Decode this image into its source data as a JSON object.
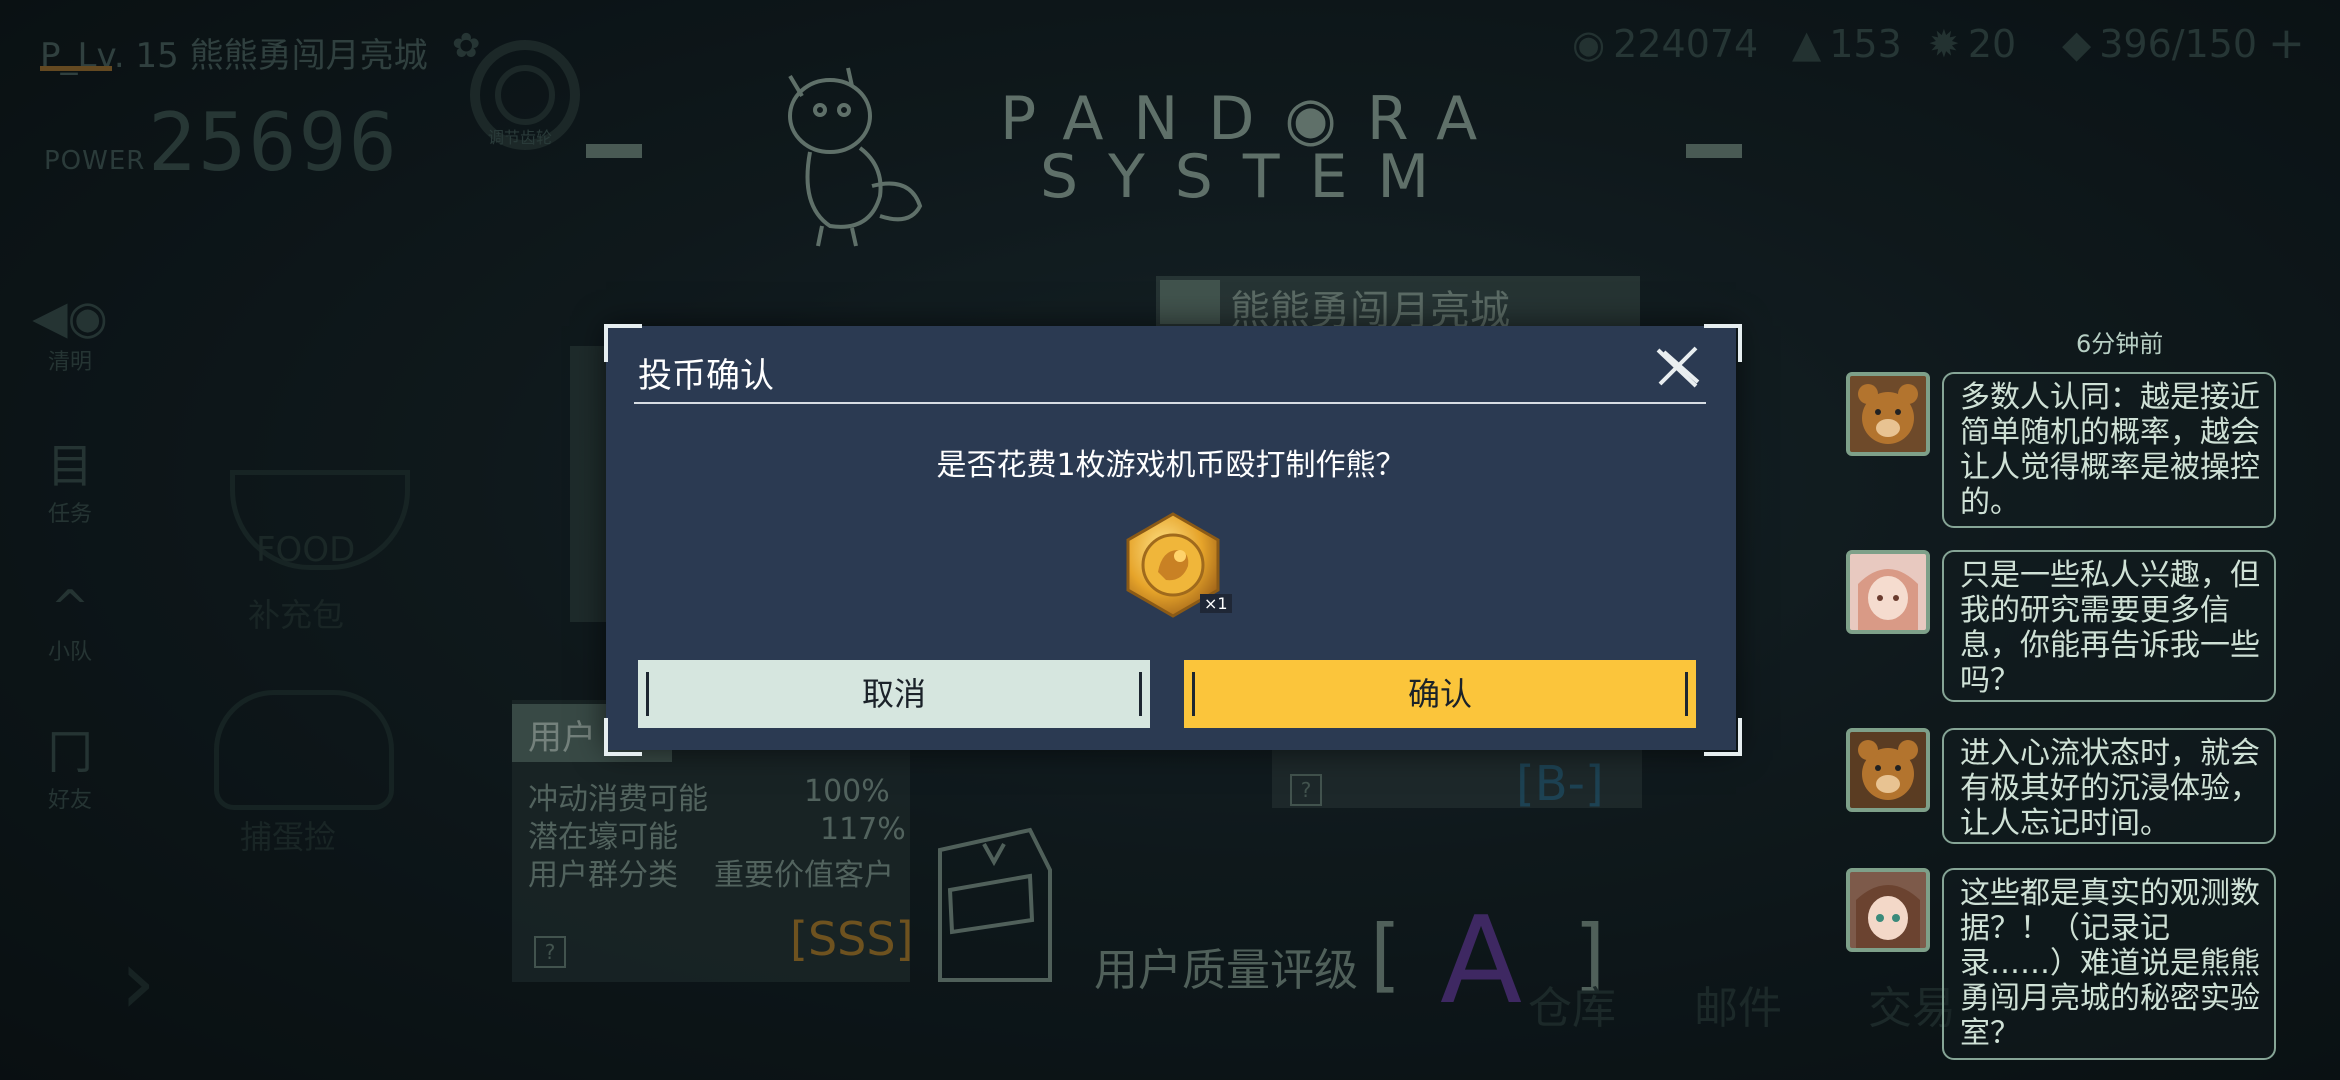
{
  "hud": {
    "player": "P_Lv. 15 熊熊勇闯月亮城",
    "power_label": "POWER",
    "power_value": "25696",
    "gear_label": "调节齿轮",
    "resources": [
      {
        "icon": "coin-stack-icon",
        "value": "224074"
      },
      {
        "icon": "warning-triangle-icon",
        "value": "153"
      },
      {
        "icon": "gear-token-icon",
        "value": "20"
      },
      {
        "icon": "ticket-icon",
        "value": "396/150"
      }
    ],
    "add_icon": "plus-icon"
  },
  "logo": {
    "line1": "PAND◉RA",
    "line2": "SYSTEM"
  },
  "side_nav": [
    {
      "icon": "fish-icon",
      "label": "清明"
    },
    {
      "icon": "task-icon",
      "label": "任务"
    },
    {
      "icon": "chevron-up-icon",
      "label": "小队"
    },
    {
      "icon": "friend-icon",
      "label": "好友"
    }
  ],
  "background": {
    "city_banner": "熊熊勇闯月亮城",
    "food_label": "FOOD",
    "food_caption": "补充包",
    "pet_caption": "捕蛋捡",
    "user_card": {
      "title": "用户",
      "stats": [
        {
          "label": "冲动消费可能",
          "value": "100%"
        },
        {
          "label": "潜在壕可能",
          "value": "117%"
        },
        {
          "label": "用户群分类",
          "value": "重要价值客户"
        }
      ],
      "help": "?",
      "grade": "[SSS]"
    },
    "bm_card": {
      "help": "?",
      "grade": "[B-]"
    },
    "quality_label": "用户质量评级",
    "quality_value": "A",
    "bottom_nav": [
      "仓库",
      "邮件",
      "交易"
    ]
  },
  "chat": {
    "time": "6分钟前",
    "messages": [
      {
        "avatar": "bear-avatar",
        "text": "多数人认同：越是接近简单随机的概率，越会让人觉得概率是被操控的。"
      },
      {
        "avatar": "pink-hair-girl-avatar",
        "text": "只是一些私人兴趣，但我的研究需要更多信息，你能再告诉我一些吗？"
      },
      {
        "avatar": "bear-avatar",
        "text": "进入心流状态时，就会有极其好的沉浸体验，让人忘记时间。"
      },
      {
        "avatar": "brown-hair-girl-avatar",
        "text": "这些都是真实的观测数据？！（记录记录……）难道说是熊熊勇闯月亮城的秘密实验室？"
      }
    ]
  },
  "modal": {
    "title": "投币确认",
    "question": "是否花费1枚游戏机币殴打制作熊？",
    "coin_icon": "game-token-coin-icon",
    "coin_qty": "×1",
    "cancel": "取消",
    "confirm": "确认",
    "colors": {
      "panel": "#2b3a52",
      "confirm": "#fbc53b",
      "cancel": "#d6e6df"
    }
  }
}
